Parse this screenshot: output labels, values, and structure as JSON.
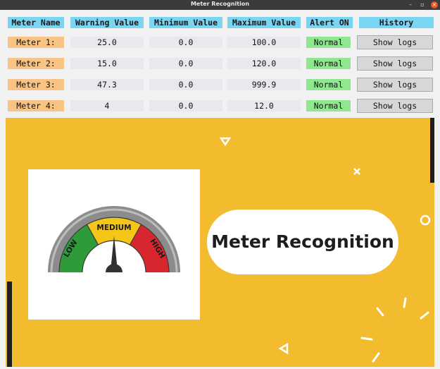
{
  "window": {
    "title": "Meter Recognition",
    "controls": [
      "–",
      "▫",
      "×"
    ]
  },
  "table": {
    "headers": [
      "Meter Name",
      "Warning Value",
      "Minimum Value",
      "Maximum Value",
      "Alert ON",
      "History"
    ],
    "rows": [
      {
        "name": "Meter 1:",
        "warning": "25.0",
        "minimum": "0.0",
        "maximum": "100.0",
        "alert": "Normal",
        "history": "Show logs"
      },
      {
        "name": "Meter 2:",
        "warning": "15.0",
        "minimum": "0.0",
        "maximum": "120.0",
        "alert": "Normal",
        "history": "Show logs"
      },
      {
        "name": "Meter 3:",
        "warning": "47.3",
        "minimum": "0.0",
        "maximum": "999.9",
        "alert": "Normal",
        "history": "Show logs"
      },
      {
        "name": "Meter 4:",
        "warning": "4",
        "minimum": "0.0",
        "maximum": "12.0",
        "alert": "Normal",
        "history": "Show logs"
      }
    ]
  },
  "banner": {
    "title": "Meter Recognition",
    "gauge": {
      "labels": [
        "LOW",
        "MEDIUM",
        "HIGH"
      ]
    },
    "background_color": "#f2bc2e"
  },
  "colors": {
    "header": "#79d5f1",
    "name_cell": "#f9c383",
    "alert_normal": "#8fe88f",
    "gauge_low": "#2e9a3a",
    "gauge_medium": "#f5c518",
    "gauge_high": "#d7262e"
  }
}
